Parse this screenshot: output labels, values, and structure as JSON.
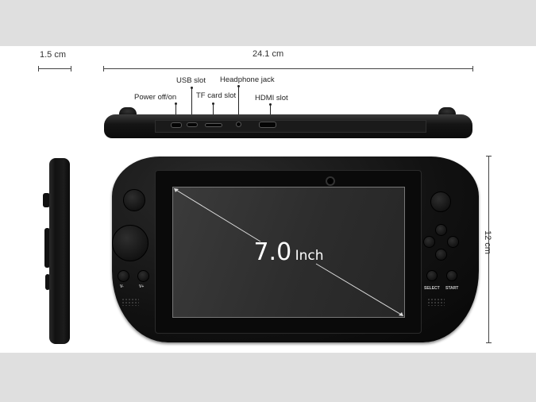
{
  "dimensions": {
    "thickness": "1.5 cm",
    "width": "24.1 cm",
    "height": "12 cm"
  },
  "ports": {
    "power": "Power off/on",
    "usb": "USB slot",
    "tf_card": "TF card slot",
    "headphone": "Headphone jack",
    "hdmi": "HDMI slot"
  },
  "screen": {
    "size_value": "7.0",
    "size_unit": "Inch"
  },
  "buttons": {
    "vol_down": "V-",
    "vol_up": "V+",
    "select": "SELECT",
    "start": "START"
  },
  "colors": {
    "background": "#dfdfdf",
    "device": "#111111",
    "screen": "#2f2f2f"
  }
}
